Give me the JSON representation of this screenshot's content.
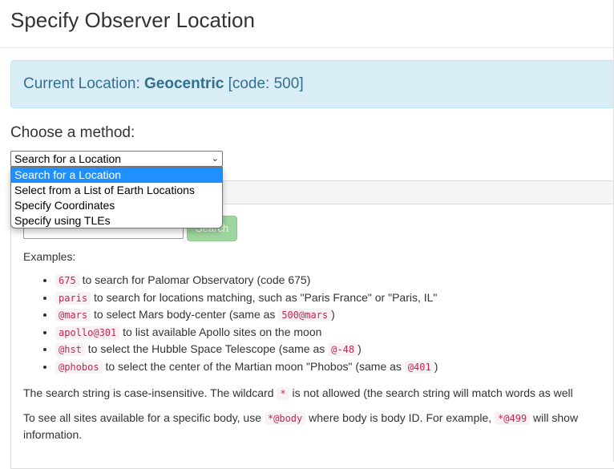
{
  "page_title": "Specify Observer Location",
  "current_location": {
    "prefix": "Current Location:",
    "name": "Geocentric",
    "code": "[code: 500]"
  },
  "method": {
    "label": "Choose a method:",
    "selected": "Search for a Location",
    "options": [
      "Search for a Location",
      "Select from a List of Earth Locations",
      "Specify Coordinates",
      "Specify using TLEs"
    ]
  },
  "search": {
    "button_label": "Search",
    "input_value": ""
  },
  "examples_label": "Examples:",
  "examples": [
    {
      "code": "675",
      "text": " to search for Palomar Observatory (code 675)"
    },
    {
      "code": "paris",
      "text": " to search for locations matching, such as \"Paris France\" or \"Paris, IL\""
    },
    {
      "code": "@mars",
      "text": " to select Mars body-center (same as ",
      "code2": "500@mars",
      "tail": ")"
    },
    {
      "code": "apollo@301",
      "text": " to list available Apollo sites on the moon"
    },
    {
      "code": "@hst",
      "text": " to select the Hubble Space Telescope (same as ",
      "code2": "@-48",
      "tail": ")"
    },
    {
      "code": "@phobos",
      "text": " to select the center of the Martian moon \"Phobos\" (same as ",
      "code2": "@401",
      "tail": ")"
    }
  ],
  "note1": {
    "pre": "The search string is case-insensitive. The wildcard ",
    "code": "*",
    "post": " is not allowed (the search string will match words as well"
  },
  "note2": {
    "pre": "To see all sites available for a specific body, use ",
    "code": "*@body",
    "mid": " where body is body ID. For example, ",
    "code2": "*@499",
    "post": " will show",
    "line2": "information."
  }
}
